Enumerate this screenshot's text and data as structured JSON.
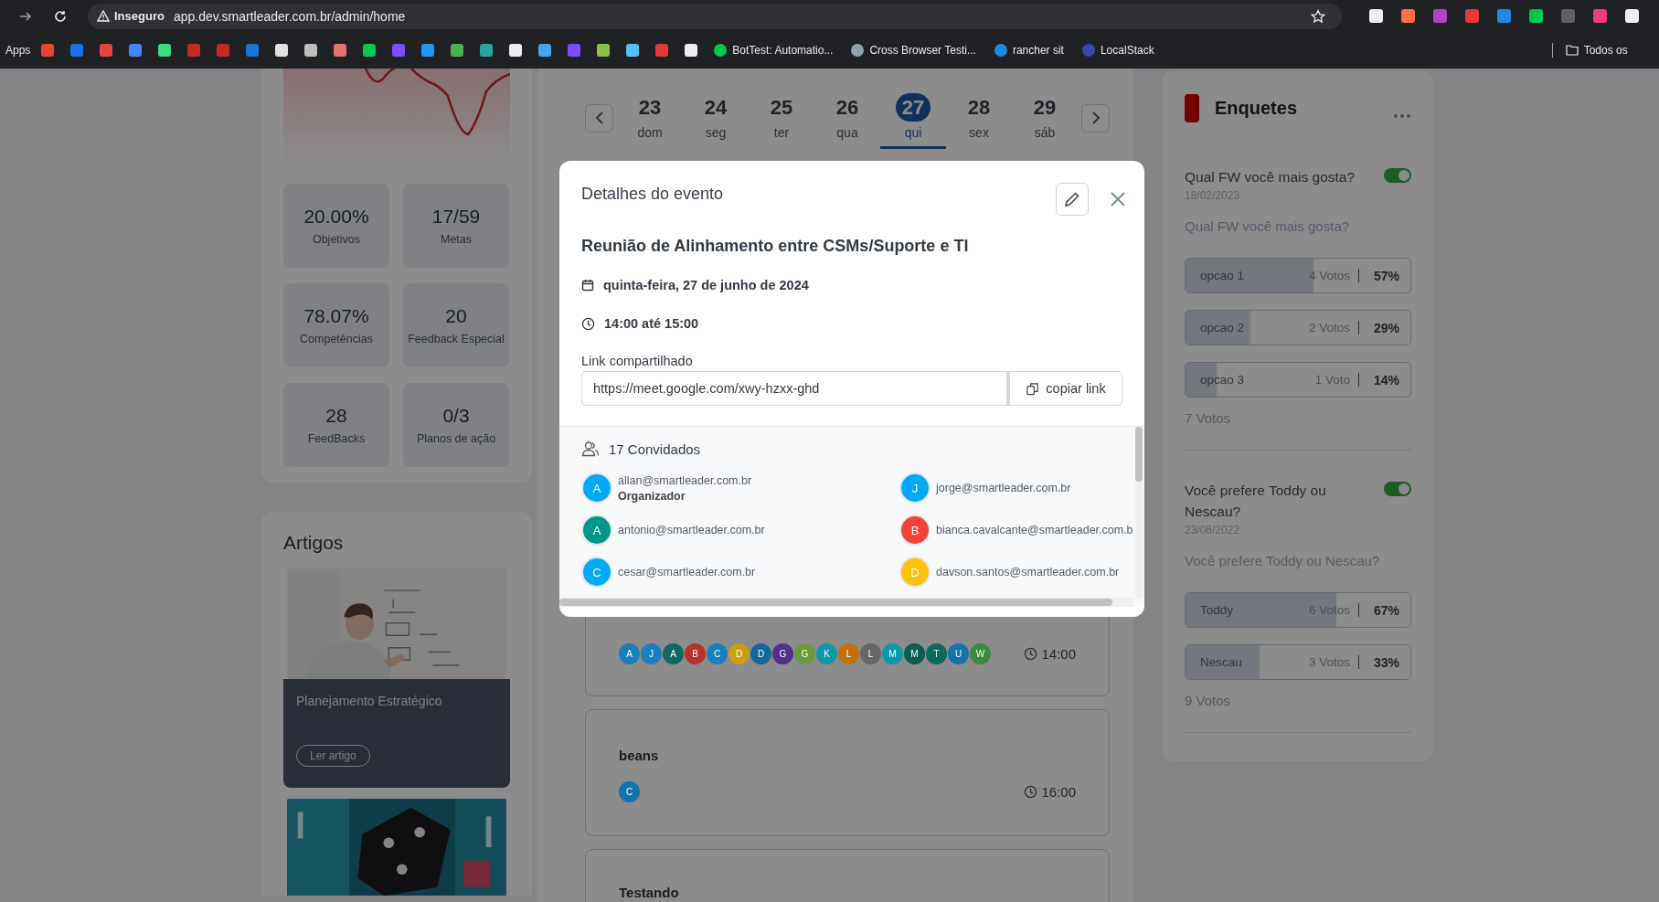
{
  "browser": {
    "security_label": "Inseguro",
    "url": "app.dev.smartleader.com.br/admin/home",
    "apps_label": "Apps",
    "bookmarks": [
      {
        "label": "BotTest: Automatio..."
      },
      {
        "label": "Cross Browser Testi..."
      },
      {
        "label": "rancher sit"
      },
      {
        "label": "LocalStack"
      }
    ],
    "all_bookmarks": "Todos os"
  },
  "stats": [
    {
      "value": "20.00%",
      "label": "Objetivos"
    },
    {
      "value": "17/59",
      "label": "Metas"
    },
    {
      "value": "78.07%",
      "label": "Competências"
    },
    {
      "value": "20",
      "label": "Feedback Especial"
    },
    {
      "value": "28",
      "label": "FeedBacks"
    },
    {
      "value": "0/3",
      "label": "Planos de ação"
    }
  ],
  "articles": {
    "title": "Artigos",
    "items": [
      {
        "kind": "card",
        "title": "Planejamento Estratégico",
        "button": "Ler artigo"
      },
      {
        "kind": "picture"
      }
    ]
  },
  "week": {
    "days": [
      {
        "number": "23",
        "weekday": "dom",
        "selected": false
      },
      {
        "number": "24",
        "weekday": "seg",
        "selected": false
      },
      {
        "number": "25",
        "weekday": "ter",
        "selected": false
      },
      {
        "number": "26",
        "weekday": "qua",
        "selected": false
      },
      {
        "number": "27",
        "weekday": "qui",
        "selected": true
      },
      {
        "number": "28",
        "weekday": "sex",
        "selected": false
      },
      {
        "number": "29",
        "weekday": "sáb",
        "selected": false
      }
    ]
  },
  "events": [
    {
      "attendees": [
        {
          "initial": "A",
          "color": "#1a80bd"
        },
        {
          "initial": "J",
          "color": "#1a80bd"
        },
        {
          "initial": "A",
          "color": "#0e6a5e"
        },
        {
          "initial": "B",
          "color": "#b8332e"
        },
        {
          "initial": "C",
          "color": "#1a80bd"
        },
        {
          "initial": "D",
          "color": "#c8a010"
        },
        {
          "initial": "D",
          "color": "#14689c"
        },
        {
          "initial": "G",
          "color": "#52308e"
        },
        {
          "initial": "G",
          "color": "#6b9a38"
        },
        {
          "initial": "K",
          "color": "#0d98a8"
        },
        {
          "initial": "L",
          "color": "#c4700a"
        },
        {
          "initial": "L",
          "color": "#666666"
        },
        {
          "initial": "M",
          "color": "#0d98a8"
        },
        {
          "initial": "M",
          "color": "#0a5e50"
        },
        {
          "initial": "T",
          "color": "#0a6a5c"
        },
        {
          "initial": "U",
          "color": "#1473aa"
        },
        {
          "initial": "W",
          "color": "#3a8a3e"
        }
      ],
      "time": "14:00"
    },
    {
      "title": "beans",
      "attendees": [
        {
          "initial": "C",
          "color": "#1473aa"
        }
      ],
      "time": "16:00"
    },
    {
      "title": "Testando"
    }
  ],
  "polls": {
    "title": "Enquetes",
    "items": [
      {
        "question": "Qual FW você mais gosta?",
        "on": true,
        "date": "18/02/2023",
        "description": "Qual FW você mais gosta?",
        "options": [
          {
            "label": "opcao 1",
            "votes": "4 Votos",
            "percent": "57%",
            "level": 0.57
          },
          {
            "label": "opcao 2",
            "votes": "2 Votos",
            "percent": "29%",
            "level": 0.29
          },
          {
            "label": "opcao 3",
            "votes": "1 Voto",
            "percent": "14%",
            "level": 0.14
          }
        ],
        "total": "7 Votos"
      },
      {
        "question": "Você prefere Toddy ou Nescau?",
        "on": true,
        "date": "23/06/2022",
        "description": "Você prefere Toddy ou Nescau?",
        "options": [
          {
            "label": "Toddy",
            "votes": "6 Votos",
            "percent": "67%",
            "level": 0.67
          },
          {
            "label": "Nescau",
            "votes": "3 Votos",
            "percent": "33%",
            "level": 0.33
          }
        ],
        "total": "9 Votos"
      }
    ]
  },
  "modal": {
    "title": "Detalhes do evento",
    "event_title": "Reunião de Alinhamento entre CSMs/Suporte e TI",
    "date": "quinta-feira, 27 de junho de 2024",
    "time": "14:00 até 15:00",
    "link_label": "Link compartilhado",
    "link": "https://meet.google.com/xwy-hzxx-ghd",
    "copy_button": "copiar link",
    "guests_title": "17 Convidados",
    "guests": [
      {
        "initial": "A",
        "email": "allan@smartleader.com.br",
        "role": "Organizador",
        "color": "#03a9f4"
      },
      {
        "initial": "J",
        "email": "jorge@smartleader.com.br",
        "color": "#03a9f4"
      },
      {
        "initial": "A",
        "email": "antonio@smartleader.com.br",
        "color": "#009688"
      },
      {
        "initial": "B",
        "email": "bianca.cavalcante@smartleader.com.b",
        "color": "#f44336"
      },
      {
        "initial": "C",
        "email": "cesar@smartleader.com.br",
        "color": "#03a9f4"
      },
      {
        "initial": "D",
        "email": "davson.santos@smartleader.com.br",
        "color": "#ffc107"
      }
    ]
  }
}
